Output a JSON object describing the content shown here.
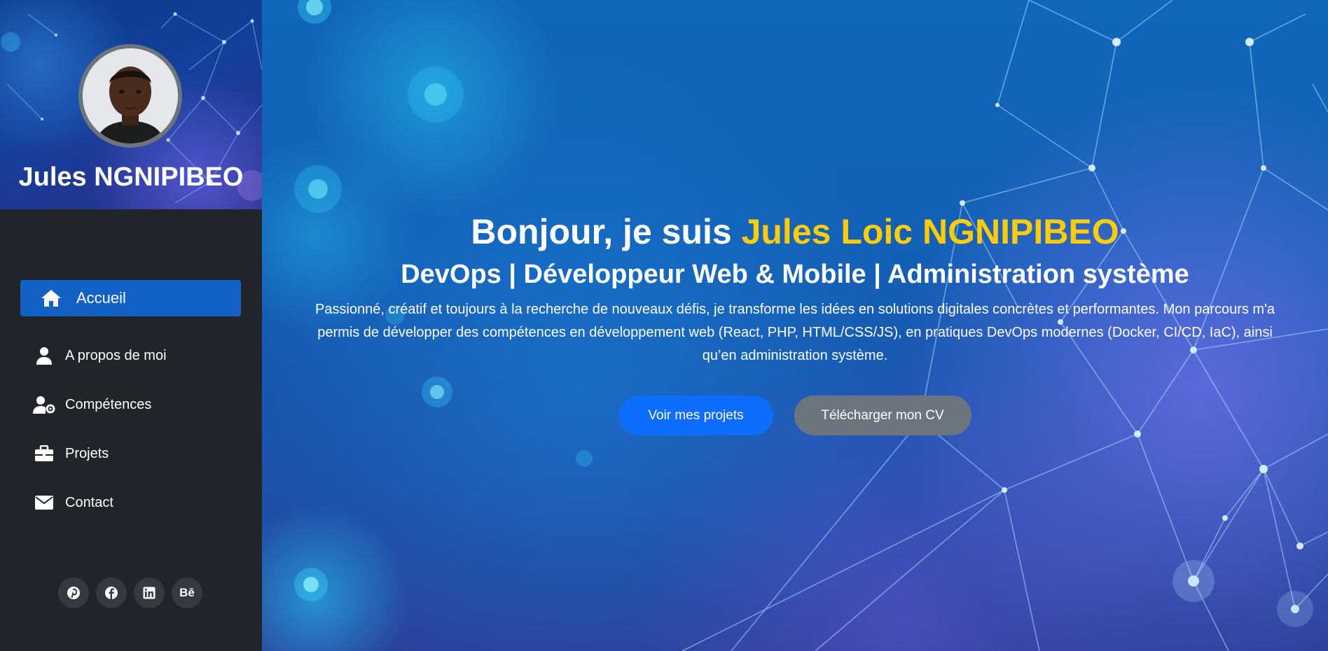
{
  "profile": {
    "name": "Jules NGNIPIBEO",
    "avatar_icon": "profile-photo"
  },
  "nav": {
    "items": [
      {
        "label": "Accueil",
        "icon": "home-icon",
        "active": true
      },
      {
        "label": "A propos de moi",
        "icon": "user-icon",
        "active": false
      },
      {
        "label": "Compétences",
        "icon": "user-gear-icon",
        "active": false
      },
      {
        "label": "Projets",
        "icon": "briefcase-icon",
        "active": false
      },
      {
        "label": "Contact",
        "icon": "envelope-icon",
        "active": false
      }
    ]
  },
  "social": {
    "items": [
      {
        "icon": "pinterest-icon"
      },
      {
        "icon": "facebook-icon"
      },
      {
        "icon": "linkedin-icon"
      },
      {
        "icon": "behance-icon",
        "label": "Bē"
      }
    ]
  },
  "hero": {
    "greeting": "Bonjour, je suis ",
    "name": "Jules Loic NGNIPIBEO",
    "subtitle": "DevOps | Développeur Web & Mobile | Administration système",
    "description": "Passionné, créatif et toujours à la recherche de nouveaux défis, je transforme les idées en solutions digitales concrètes et performantes. Mon parcours m'a permis de développer des compétences en développement web (React, PHP, HTML/CSS/JS), en pratiques DevOps modernes (Docker, CI/CD, IaC), ainsi qu’en administration système.",
    "primary_button": "Voir mes projets",
    "secondary_button": "Télécharger mon CV"
  },
  "colors": {
    "sidebar_bg": "#212529",
    "nav_active": "#1361c4",
    "accent_name": "#ffcc0a",
    "primary_button": "#0d6efd",
    "secondary_button": "#6c757d"
  }
}
